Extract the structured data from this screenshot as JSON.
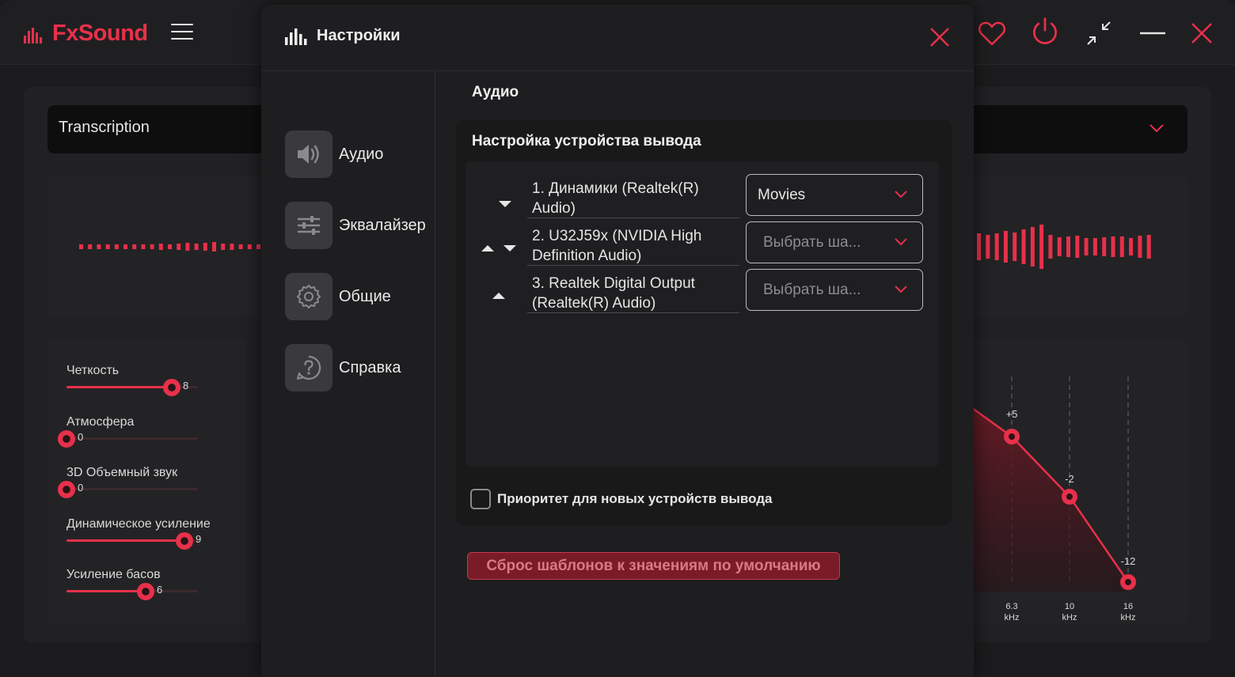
{
  "app": {
    "brand": "FxSound",
    "preset": "Transcription",
    "effects": [
      {
        "label": "Четкость",
        "value": 8,
        "max": 10
      },
      {
        "label": "Атмосфера",
        "value": 0,
        "max": 10
      },
      {
        "label": "3D Объемный звук",
        "value": 0,
        "max": 10
      },
      {
        "label": "Динамическое усиление",
        "value": 9,
        "max": 10
      },
      {
        "label": "Усиление басов",
        "value": 6,
        "max": 10
      }
    ],
    "eq": {
      "bands": [
        {
          "freq": "6.3",
          "unit": "kHz",
          "gain": "+5"
        },
        {
          "freq": "10",
          "unit": "kHz",
          "gain": "-2"
        },
        {
          "freq": "16",
          "unit": "kHz",
          "gain": "-12"
        }
      ]
    },
    "colors": {
      "accent": "#e8304a",
      "background": "#1c1c1e"
    }
  },
  "settings": {
    "title": "Настройки",
    "nav": [
      {
        "label": "Аудио",
        "icon": "speaker-icon"
      },
      {
        "label": "Эквалайзер",
        "icon": "sliders-icon"
      },
      {
        "label": "Общие",
        "icon": "gear-icon"
      },
      {
        "label": "Справка",
        "icon": "help-icon"
      }
    ],
    "section_title": "Аудио",
    "device_card_title": "Настройка устройства вывода",
    "devices": [
      {
        "name": "1. Динамики (Realtek(R) Audio)",
        "preset": "Movies",
        "placeholder": false
      },
      {
        "name": "2. U32J59x (NVIDIA High Definition Audio)",
        "preset": "Выбрать ша...",
        "placeholder": true
      },
      {
        "name": "3. Realtek Digital Output (Realtek(R) Audio)",
        "preset": "Выбрать ша...",
        "placeholder": true
      }
    ],
    "priority_label": "Приоритет для новых устройств вывода",
    "reset_label": "Сброс шаблонов к значениям по умолчанию"
  }
}
